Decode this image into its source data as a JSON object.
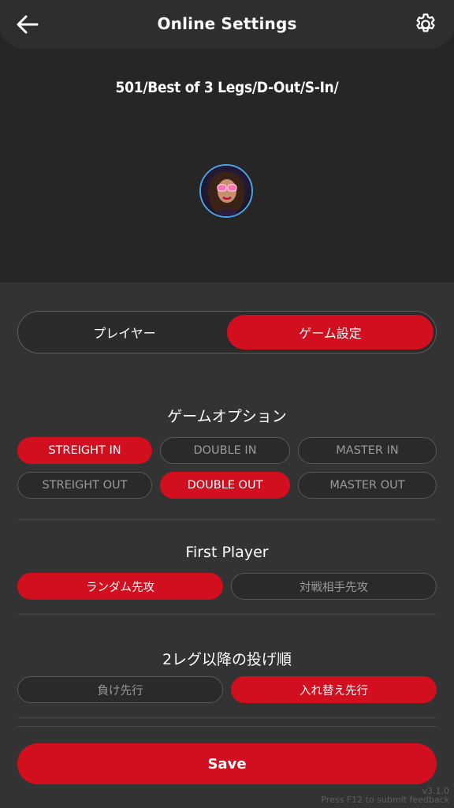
{
  "header": {
    "title": "Online Settings",
    "back_icon": "arrow-left-icon",
    "settings_icon": "gear-icon"
  },
  "game_summary": "501/Best of 3 Legs/D-Out/S-In/",
  "tabs": [
    {
      "label": "プレイヤー",
      "active": false
    },
    {
      "label": "ゲーム設定",
      "active": true
    }
  ],
  "game_options": {
    "title": "ゲームオプション",
    "row1": [
      {
        "label": "STREIGHT IN",
        "active": true
      },
      {
        "label": "DOUBLE IN",
        "active": false
      },
      {
        "label": "MASTER IN",
        "active": false
      }
    ],
    "row2": [
      {
        "label": "STREIGHT OUT",
        "active": false
      },
      {
        "label": "DOUBLE OUT",
        "active": true
      },
      {
        "label": "MASTER OUT",
        "active": false
      }
    ]
  },
  "first_player": {
    "title": "First Player",
    "options": [
      {
        "label": "ランダム先攻",
        "active": true
      },
      {
        "label": "対戦相手先攻",
        "active": false
      }
    ]
  },
  "throw_order": {
    "title": "2レグ以降の投げ順",
    "options": [
      {
        "label": "負け先行",
        "active": false
      },
      {
        "label": "入れ替え先行",
        "active": true
      }
    ]
  },
  "save_label": "Save",
  "footer": {
    "version": "v3.1.0",
    "feedback": "Press F12 to submit feedback"
  },
  "colors": {
    "accent": "#d10f1e",
    "background": "#262626",
    "panel": "#333333",
    "avatar_ring": "#4aa3e8"
  }
}
